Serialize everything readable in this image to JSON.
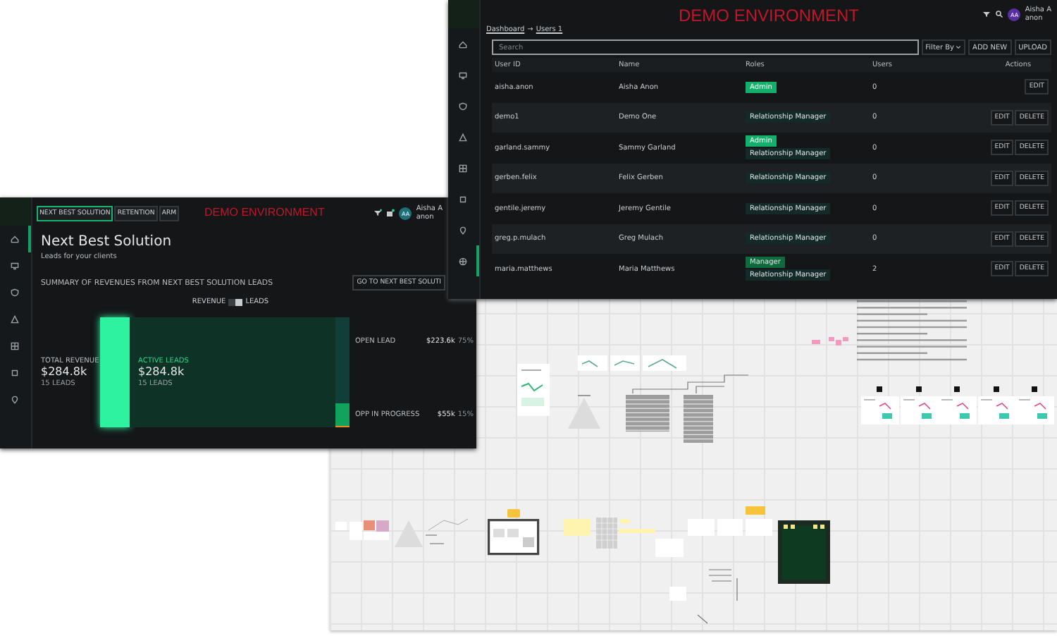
{
  "users_window": {
    "title": "DEMO ENVIRONMENT",
    "breadcrumb": {
      "parent": "Dashboard",
      "separator": "→",
      "current": "Users 1"
    },
    "user": {
      "initials": "AA",
      "name": "Aisha A",
      "subtitle": "anon"
    },
    "sidebar": [
      {
        "selected": false
      },
      {
        "selected": false
      },
      {
        "selected": false
      },
      {
        "selected": false
      },
      {
        "selected": false
      },
      {
        "selected": false
      },
      {
        "selected": false
      },
      {
        "selected": true
      }
    ],
    "search": {
      "placeholder": "Search"
    },
    "filter": "Filter By",
    "buttons": [
      "ADD NEW",
      "UPLOAD"
    ],
    "columns": [
      "User ID",
      "Name",
      "Roles",
      "Users",
      "Actions"
    ],
    "rows": [
      {
        "user_id": "aisha.anon",
        "name": "Aisha Anon",
        "roles": [
          {
            "label": "Admin",
            "kind": "admin"
          }
        ],
        "users": "0",
        "actions": [
          "EDIT"
        ]
      },
      {
        "user_id": "demo1",
        "name": "Demo One",
        "roles": [
          {
            "label": "Relationship Manager",
            "kind": "rm"
          }
        ],
        "users": "0",
        "actions": [
          "EDIT",
          "DELETE"
        ]
      },
      {
        "user_id": "garland.sammy",
        "name": "Sammy Garland",
        "roles": [
          {
            "label": "Admin",
            "kind": "admin"
          },
          {
            "label": "Relationship Manager",
            "kind": "rm"
          }
        ],
        "users": "0",
        "actions": [
          "EDIT",
          "DELETE"
        ]
      },
      {
        "user_id": "gerben.felix",
        "name": "Felix Gerben",
        "roles": [
          {
            "label": "Relationship Manager",
            "kind": "rm"
          }
        ],
        "users": "0",
        "actions": [
          "EDIT",
          "DELETE"
        ]
      },
      {
        "user_id": "gentile.jeremy",
        "name": "Jeremy Gentile",
        "roles": [
          {
            "label": "Relationship Manager",
            "kind": "rm"
          }
        ],
        "users": "0",
        "actions": [
          "EDIT",
          "DELETE"
        ]
      },
      {
        "user_id": "greg.p.mulach",
        "name": "Greg Mulach",
        "roles": [
          {
            "label": "Relationship Manager",
            "kind": "rm"
          }
        ],
        "users": "0",
        "actions": [
          "EDIT",
          "DELETE"
        ]
      },
      {
        "user_id": "maria.matthews",
        "name": "Maria Matthews",
        "roles": [
          {
            "label": "Manager",
            "kind": "manager"
          },
          {
            "label": "Relationship Manager",
            "kind": "rm"
          }
        ],
        "users": "2",
        "actions": [
          "EDIT",
          "DELETE"
        ]
      }
    ]
  },
  "nbs_window": {
    "title": "DEMO ENVIRONMENT",
    "tabs": [
      {
        "label": "NEXT BEST SOLUTION",
        "selected": true
      },
      {
        "label": "RETENTION",
        "selected": false
      },
      {
        "label": "ARM",
        "selected": false
      }
    ],
    "user": {
      "initials": "AA",
      "name": "Aisha A",
      "subtitle": "anon"
    },
    "sidebar": [
      {
        "selected": true
      },
      {
        "selected": false
      },
      {
        "selected": false
      },
      {
        "selected": false
      },
      {
        "selected": false
      },
      {
        "selected": false
      },
      {
        "selected": false
      }
    ],
    "heading": "Next Best Solution",
    "subheading": "Leads for your clients",
    "summary_title": "SUMMARY OF REVENUES FROM NEXT BEST SOLUTION LEADS",
    "summary_button": "GO TO NEXT BEST SOLUTI",
    "toggle": {
      "left": "REVENUE",
      "right": "LEADS",
      "on": true
    },
    "total": {
      "label": "TOTAL REVENUE",
      "value": "$284.8k",
      "count": "15 LEADS"
    },
    "active": {
      "label": "ACTIVE LEADS",
      "value": "$284.8k",
      "count": "15 LEADS"
    },
    "breakdown": [
      {
        "label": "OPEN LEAD",
        "value": "$223.6k",
        "share": "75%"
      },
      {
        "label": "OPP IN PROGRESS",
        "value": "$55k",
        "share": "15%"
      }
    ]
  }
}
